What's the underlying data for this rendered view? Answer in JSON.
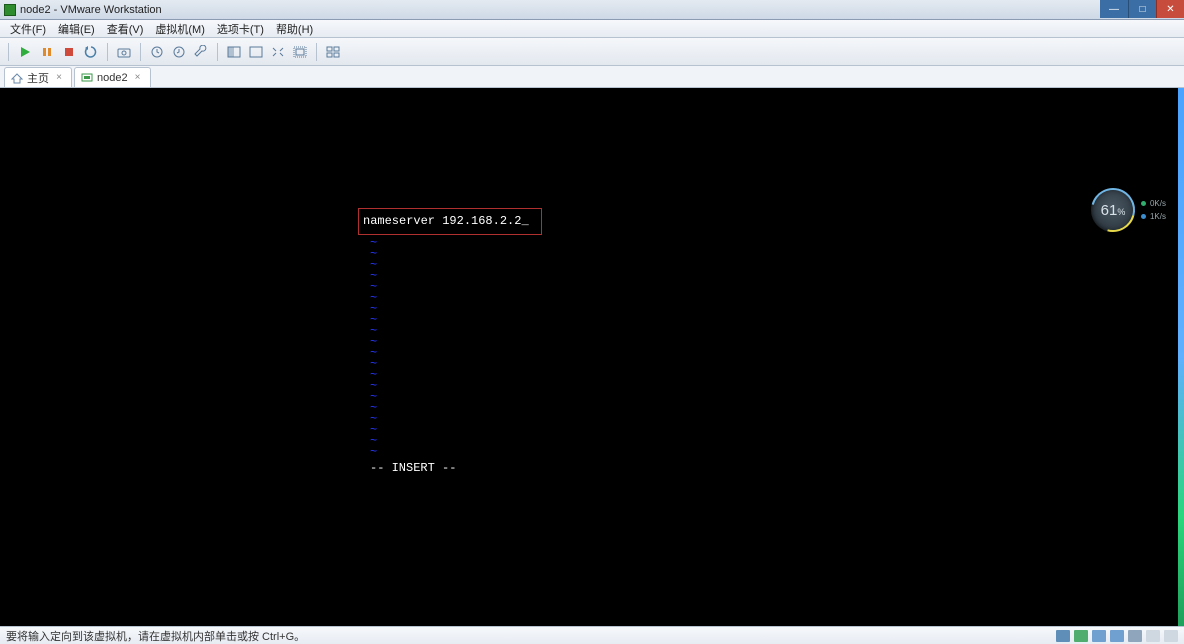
{
  "window": {
    "title": "node2 - VMware Workstation"
  },
  "menu": {
    "file": "文件(F)",
    "edit": "编辑(E)",
    "view": "查看(V)",
    "vm": "虚拟机(M)",
    "tabs": "选项卡(T)",
    "help": "帮助(H)"
  },
  "tabs": {
    "home": "主页",
    "node2": "node2"
  },
  "toolbar_icons": {
    "power_on": "power-on-icon",
    "pause": "pause-icon",
    "stop": "stop-icon",
    "restart": "restart-icon",
    "snapshot": "snapshot-icon",
    "snap_take": "snapshot-take-icon",
    "snap_revert": "snapshot-revert-icon",
    "snap_manage": "snapshot-manage-icon",
    "fullscreen": "fullscreen-icon",
    "unity": "unity-icon",
    "fit": "fit-guest-icon",
    "stretch": "stretch-icon",
    "thumbs": "thumbnail-icon"
  },
  "terminal": {
    "content_line": "nameserver 192.168.2.2",
    "cursor": "_",
    "tilde": "~",
    "tilde_count": 20,
    "status_line": "-- INSERT --"
  },
  "gauge": {
    "percent": "61",
    "suffix": "%",
    "up": "0K/s",
    "down": "1K/s"
  },
  "statusbar": {
    "hint": "要将输入定向到该虚拟机，请在虚拟机内部单击或按 Ctrl+G。"
  }
}
